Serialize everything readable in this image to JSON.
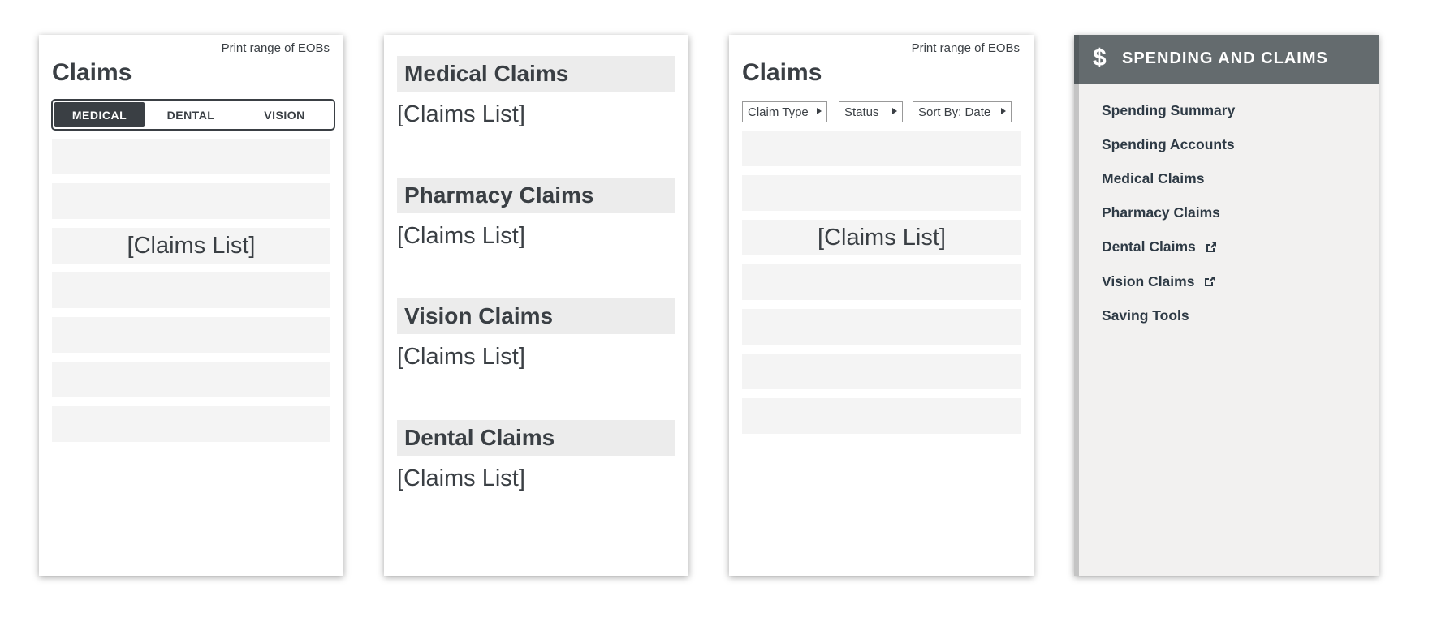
{
  "panel1": {
    "print_link": "Print range of EOBs",
    "title": "Claims",
    "tabs": [
      {
        "label": "MEDICAL",
        "active": true
      },
      {
        "label": "DENTAL",
        "active": false
      },
      {
        "label": "VISION",
        "active": false
      }
    ],
    "rows": [
      "",
      "",
      "[Claims List]",
      "",
      "",
      "",
      ""
    ]
  },
  "panel2": {
    "sections": [
      {
        "heading": "Medical Claims",
        "list": "[Claims List]"
      },
      {
        "heading": "Pharmacy Claims",
        "list": "[Claims List]"
      },
      {
        "heading": "Vision Claims",
        "list": "[Claims List]"
      },
      {
        "heading": "Dental Claims",
        "list": "[Claims List]"
      }
    ]
  },
  "panel3": {
    "print_link": "Print range of EOBs",
    "title": "Claims",
    "filters": [
      {
        "label": "Claim Type",
        "icon": "triangle-right-icon"
      },
      {
        "label": "Status",
        "icon": "triangle-right-icon"
      },
      {
        "label": "Sort By: Date",
        "icon": "triangle-right-icon"
      }
    ],
    "rows": [
      "",
      "",
      "[Claims List]",
      "",
      "",
      "",
      ""
    ]
  },
  "panel4": {
    "header_icon": "dollar-icon",
    "header_icon_glyph": "$",
    "header_title": "SPENDING AND CLAIMS",
    "items": [
      {
        "label": "Spending Summary",
        "external": false
      },
      {
        "label": "Spending Accounts",
        "external": false
      },
      {
        "label": "Medical Claims",
        "external": false
      },
      {
        "label": "Pharmacy Claims",
        "external": false
      },
      {
        "label": "Dental Claims",
        "external": true
      },
      {
        "label": "Vision Claims",
        "external": true
      },
      {
        "label": "Saving Tools",
        "external": false
      }
    ]
  },
  "colors": {
    "text": "#3a3f44",
    "active_tab": "#3a3f44",
    "row_bg": "#f4f4f4",
    "section_head_bg": "#ececec",
    "menu_header_bg": "#646b6e",
    "menu_bg": "#f2f1f0",
    "menu_text": "#2e3a45"
  }
}
